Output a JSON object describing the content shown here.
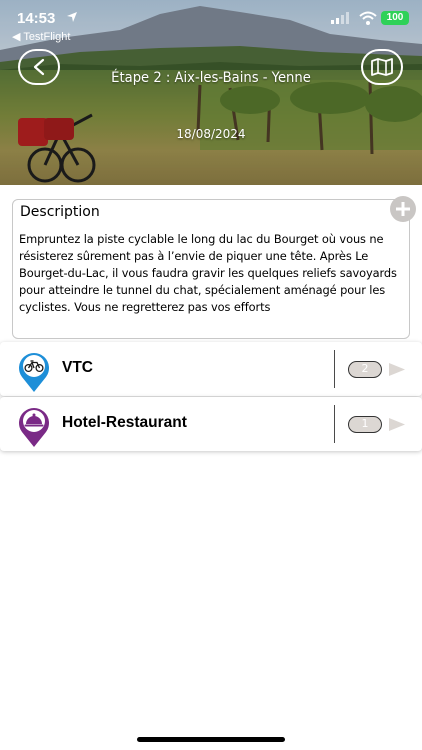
{
  "status_bar": {
    "time": "14:53",
    "back_app": "◀ TestFlight",
    "battery": "100",
    "battery_color": "#2fd158"
  },
  "header": {
    "title": "Étape 2 : Aix-les-Bains - Yenne",
    "date": "18/08/2024",
    "back_icon": "chevron-left-icon",
    "map_icon": "folded-map-icon"
  },
  "description": {
    "title": "Description",
    "text": "Empruntez la piste cyclable le long du lac du Bourget où vous ne résisterez sûrement pas à l’envie de piquer une tête. Après Le Bourget-du-Lac, il vous faudra gravir les quelques reliefs savoyards pour atteindre le tunnel du chat, spécialement aménagé pour les cyclistes. Vous ne regretterez pas vos efforts",
    "add_icon": "plus-icon"
  },
  "services": [
    {
      "label": "VTC",
      "count": "2",
      "icon": "bicycle-pin-icon",
      "color": "#1e8fd8"
    },
    {
      "label": "Hotel-Restaurant",
      "count": "1",
      "icon": "cloche-pin-icon",
      "color": "#7a2a86"
    }
  ]
}
